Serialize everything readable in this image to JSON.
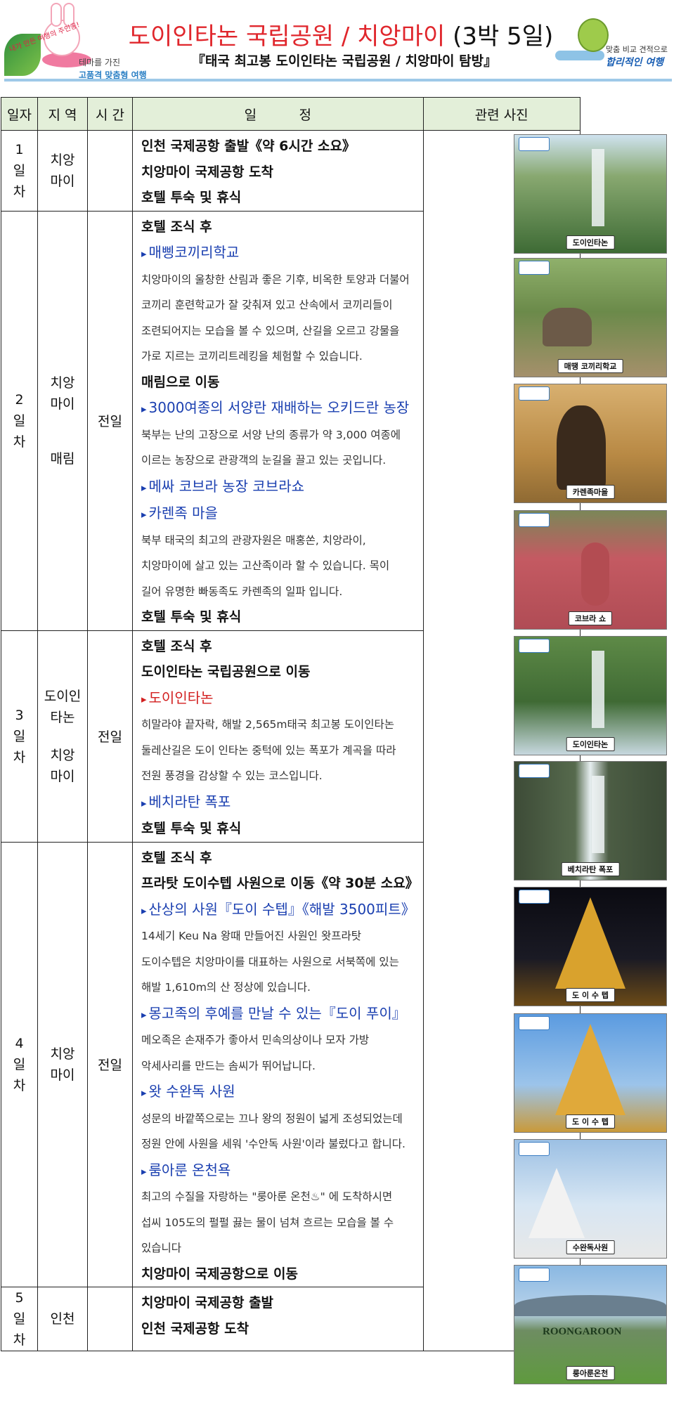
{
  "header": {
    "left_hand_text": "내가 만든 여행의 주인공!",
    "left_small": "테마를 가진",
    "left_main": "고품격 맞춤형 여행",
    "title_red": "도이인타논 국립공원 / 치앙마이",
    "title_black": "(3박 5일)",
    "subtitle": "『태국 최고봉 도이인타논 국립공원 / 치앙마이 탐방』",
    "right_small": "맞춤 비교 견적으로",
    "right_main": "합리적인 여행"
  },
  "table": {
    "headers": {
      "day": "일자",
      "region": "지 역",
      "time": "시 간",
      "schedule": "일          정",
      "photos": "관련 사진"
    }
  },
  "days": [
    {
      "day": [
        "1",
        "일",
        "차"
      ],
      "region": [
        "치앙",
        "마이"
      ],
      "time": "",
      "lines": [
        {
          "text": "인천 국제공항 출발《약 6시간 소요》",
          "style": "bold"
        },
        {
          "text": "치앙마이 국제공항 도착",
          "style": "bold"
        },
        {
          "text": "호텔 투숙 및 휴식",
          "style": "bold"
        }
      ]
    },
    {
      "day": [
        "2",
        "일",
        "차"
      ],
      "region": [
        "치앙",
        "마이",
        "",
        "",
        "매림"
      ],
      "time": "전일",
      "lines": [
        {
          "text": "호텔 조식 후",
          "style": "bold"
        },
        {
          "text": "매삥코끼리학교",
          "style": "blue"
        },
        {
          "text": "치앙마이의 울창한 산림과 좋은 기후, 비옥한 토양과 더불어",
          "style": "desc"
        },
        {
          "text": "코끼리 훈련학교가 잘 갖춰져 있고 산속에서 코끼리들이",
          "style": "desc"
        },
        {
          "text": "조련되어지는 모습을 볼 수 있으며, 산길을 오르고 강물을",
          "style": "desc"
        },
        {
          "text": "가로 지르는 코끼리트레킹을 체험할 수 있습니다.",
          "style": "desc"
        },
        {
          "text": "매림으로 이동",
          "style": "bold"
        },
        {
          "text": "3000여종의 서양란 재배하는 오키드란 농장",
          "style": "blue"
        },
        {
          "text": "북부는 난의 고장으로 서양 난의 종류가 약 3,000 여종에",
          "style": "desc"
        },
        {
          "text": "이르는 농장으로 관광객의 눈길을 끌고 있는 곳입니다.",
          "style": "desc"
        },
        {
          "text": "메싸 코브라 농장 코브라쇼",
          "style": "blue"
        },
        {
          "text": "카렌족 마을",
          "style": "blue"
        },
        {
          "text": "북부 태국의 최고의 관광자원은 매홍쏜, 치앙라이,",
          "style": "desc"
        },
        {
          "text": "치앙마이에 살고 있는 고산족이라 할 수 있습니다.  목이",
          "style": "desc"
        },
        {
          "text": "길어 유명한 빠동족도 카렌족의 일파 입니다.",
          "style": "desc"
        },
        {
          "text": "호텔 투숙 및 휴식",
          "style": "bold"
        }
      ]
    },
    {
      "day": [
        "3",
        "일",
        "차"
      ],
      "region": [
        "도이인",
        "타논",
        "",
        "치앙",
        "마이"
      ],
      "time": "전일",
      "lines": [
        {
          "text": "호텔 조식 후",
          "style": "bold"
        },
        {
          "text": "도이인타논 국립공원으로 이동",
          "style": "bold"
        },
        {
          "text": "도이인타논",
          "style": "red"
        },
        {
          "text": "히말라야 끝자락, 해발 2,565m태국 최고봉 도이인타논",
          "style": "desc"
        },
        {
          "text": "둘레산길은 도이 인타논 중턱에 있는 폭포가 계곡을 따라",
          "style": "desc"
        },
        {
          "text": "전원 풍경을 감상할 수 있는 코스입니다.",
          "style": "desc"
        },
        {
          "text": "베치라탄 폭포",
          "style": "blue"
        },
        {
          "text": "호텔 투숙 및 휴식",
          "style": "bold"
        }
      ]
    },
    {
      "day": [
        "4",
        "일",
        "차"
      ],
      "region": [
        "치앙",
        "마이"
      ],
      "time": "전일",
      "lines": [
        {
          "text": "호텔 조식 후",
          "style": "bold"
        },
        {
          "text": "프라탓 도이수텝 사원으로 이동《약 30분 소요》",
          "style": "bold"
        },
        {
          "text": "산상의 사원『도이 수텝』《해발 3500피트》",
          "style": "blue"
        },
        {
          "text": "14세기 Keu Na 왕때 만들어진 사원인 왓프라탓",
          "style": "desc"
        },
        {
          "text": "도이수텝은 치앙마이를 대표하는 사원으로 서북쪽에 있는",
          "style": "desc"
        },
        {
          "text": "해발 1,610m의 산 정상에 있습니다.",
          "style": "desc"
        },
        {
          "text": "몽고족의 후예를 만날 수 있는『도이 푸이』",
          "style": "blue"
        },
        {
          "text": "메오족은 손재주가 좋아서 민속의상이나 모자 가방",
          "style": "desc"
        },
        {
          "text": "악세사리를 만드는 솜씨가 뛰어납니다.",
          "style": "desc"
        },
        {
          "text": "왓 수완독 사원",
          "style": "blue"
        },
        {
          "text": "성문의 바깥쪽으로는 끄나 왕의 정원이 넓게 조성되었는데",
          "style": "desc"
        },
        {
          "text": "정원 안에 사원을 세워 '수안독 사원'이라 불렀다고 합니다.",
          "style": "desc"
        },
        {
          "text": "룸아룬 온천욕",
          "style": "blue"
        },
        {
          "text": "최고의 수질을 자랑하는 \"룽아룬 온천♨\" 에 도착하시면",
          "style": "desc"
        },
        {
          "text": "섭씨 105도의 펄펄 끓는 물이 넘쳐 흐르는 모습을 볼 수",
          "style": "desc"
        },
        {
          "text": "있습니다",
          "style": "desc"
        },
        {
          "text": "치앙마이 국제공항으로 이동",
          "style": "bold"
        }
      ]
    },
    {
      "day": [
        "5",
        "일",
        "차"
      ],
      "region": [
        "인천"
      ],
      "time": "",
      "lines": [
        {
          "text": "치앙마이 국제공항 출발",
          "style": "bold"
        },
        {
          "text": "인천 국제공항 도착",
          "style": "bold"
        }
      ]
    }
  ],
  "photos": [
    {
      "caption": "도이인타논",
      "scene": "waterfall-forest"
    },
    {
      "caption": "매땡 코끼리학교",
      "scene": "elephants"
    },
    {
      "caption": "카렌족마을",
      "scene": "karen-woman"
    },
    {
      "caption": "코브라 쇼",
      "scene": "cobra-show"
    },
    {
      "caption": "도이인타논",
      "scene": "stream-forest"
    },
    {
      "caption": "베치라탄 폭포",
      "scene": "tall-waterfall"
    },
    {
      "caption": "도 이 수 텝",
      "scene": "golden-pagoda-night"
    },
    {
      "caption": "도 이 수 텝",
      "scene": "golden-pagoda-day"
    },
    {
      "caption": "수완독사원",
      "scene": "white-stupas"
    },
    {
      "caption": "룽아룬온천",
      "scene": "hotspring-lawn",
      "sign": "ROONGAROON"
    }
  ],
  "colors": {
    "title_red": "#e0262c",
    "header_bg": "#e3efd9",
    "link_blue": "#1a3fb0",
    "highlight_red": "#d21f1f"
  }
}
